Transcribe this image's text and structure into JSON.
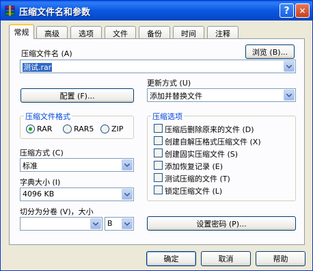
{
  "window": {
    "title": "压缩文件名和参数",
    "help_symbol": "?",
    "close_symbol": "✕"
  },
  "tabs": [
    {
      "label": "常规",
      "active": true
    },
    {
      "label": "高级"
    },
    {
      "label": "选项"
    },
    {
      "label": "文件"
    },
    {
      "label": "备份"
    },
    {
      "label": "时间"
    },
    {
      "label": "注释"
    }
  ],
  "archive_name": {
    "label": "压缩文件名 (A)",
    "value": "测试.rar",
    "browse_button": "浏览 (B)..."
  },
  "update_mode": {
    "label": "更新方式 (U)",
    "value": "添加并替换文件"
  },
  "profiles_button": "配置 (F)...",
  "archive_format": {
    "title": "压缩文件格式",
    "options": [
      "RAR",
      "RAR5",
      "ZIP"
    ],
    "selected": "RAR"
  },
  "compression_method": {
    "label": "压缩方式 (C)",
    "value": "标准"
  },
  "dictionary_size": {
    "label": "字典大小 (I)",
    "value": "4096 KB"
  },
  "split_volumes": {
    "label": "切分为分卷 (V)，大小",
    "value": "",
    "unit": "B"
  },
  "archiving_options": {
    "title": "压缩选项",
    "items": [
      {
        "label": "压缩后删除原来的文件 (D)",
        "checked": false
      },
      {
        "label": "创建自解压格式压缩文件 (X)",
        "checked": false
      },
      {
        "label": "创建固实压缩文件 (S)",
        "checked": false
      },
      {
        "label": "添加恢复记录 (E)",
        "checked": false
      },
      {
        "label": "测试压缩的文件 (T)",
        "checked": false
      },
      {
        "label": "锁定压缩文件 (L)",
        "checked": false
      }
    ]
  },
  "password_button": "设置密码 (P)...",
  "footer": {
    "ok": "确定",
    "cancel": "取消",
    "help": "帮助"
  },
  "colors": {
    "titlebar": "#0A58E0",
    "group_title": "#0046D5",
    "selection": "#316AC5",
    "radio_dot": "#21A121"
  }
}
